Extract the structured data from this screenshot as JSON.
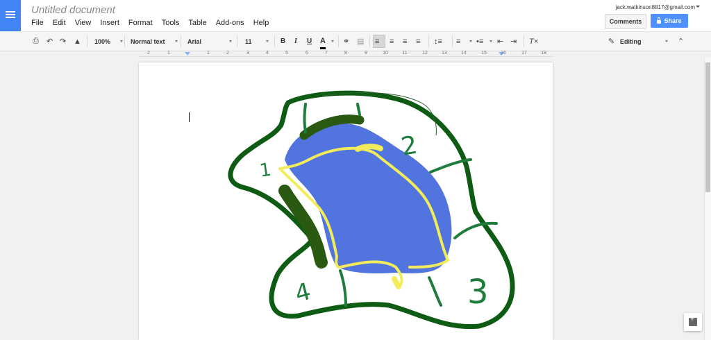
{
  "header": {
    "doc_title": "Untitled document",
    "account": "jack.watkinson8817@gmail.com",
    "comments_label": "Comments",
    "share_label": "Share"
  },
  "menu": [
    "File",
    "Edit",
    "View",
    "Insert",
    "Format",
    "Tools",
    "Table",
    "Add-ons",
    "Help"
  ],
  "toolbar": {
    "zoom": "100%",
    "style": "Normal text",
    "font": "Arial",
    "size": "11",
    "bold": "B",
    "italic": "I",
    "underline": "U",
    "text_color": "A",
    "mode": "Editing"
  },
  "ruler": [
    "2",
    "1",
    "1",
    "2",
    "3",
    "4",
    "5",
    "6",
    "7",
    "8",
    "9",
    "10",
    "11",
    "12",
    "13",
    "14",
    "15",
    "16",
    "17",
    "18"
  ],
  "drawing": {
    "labels": [
      "1",
      "2",
      "3",
      "4"
    ],
    "colors": {
      "ocean": "#5174de",
      "coast": "#f3ec5a",
      "border": "#0e5c13",
      "forest": "#2a5a12",
      "rivers": "#1e7d3c"
    }
  }
}
